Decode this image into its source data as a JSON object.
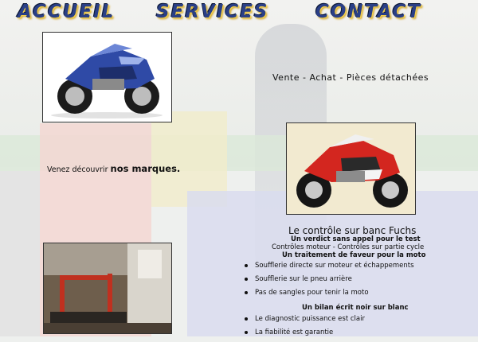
{
  "nav": {
    "accueil": "ACCUEIL",
    "services": "SERVICES",
    "contact": "CONTACT"
  },
  "hero": {
    "tagline": "Vente - Achat - Pièces détachées"
  },
  "brands": {
    "prefix": "Venez découvrir ",
    "emphasis": "nos marques."
  },
  "bench": {
    "title": "Le contrôle sur banc Fuchs",
    "subtitle1": "Un verdict sans appel pour le test",
    "subtitle2": "Contrôles moteur - Contrôles sur partie cycle",
    "subtitle3": "Un traitement de faveur pour la moto",
    "list1": [
      "Soufflerie directe sur moteur et échappements",
      "Soufflerie sur le pneu arrière",
      "Pas de sangles pour tenir la moto"
    ],
    "subtitle4": "Un bilan écrit noir sur blanc",
    "list2": [
      "Le diagnostic puissance est clair",
      "La fiabilité est garantie"
    ]
  },
  "colors": {
    "nav_text": "#2a3f86",
    "nav_glow": "#f5d24a",
    "moto_blue": "#2f4aa6",
    "moto_red": "#d3261f"
  }
}
